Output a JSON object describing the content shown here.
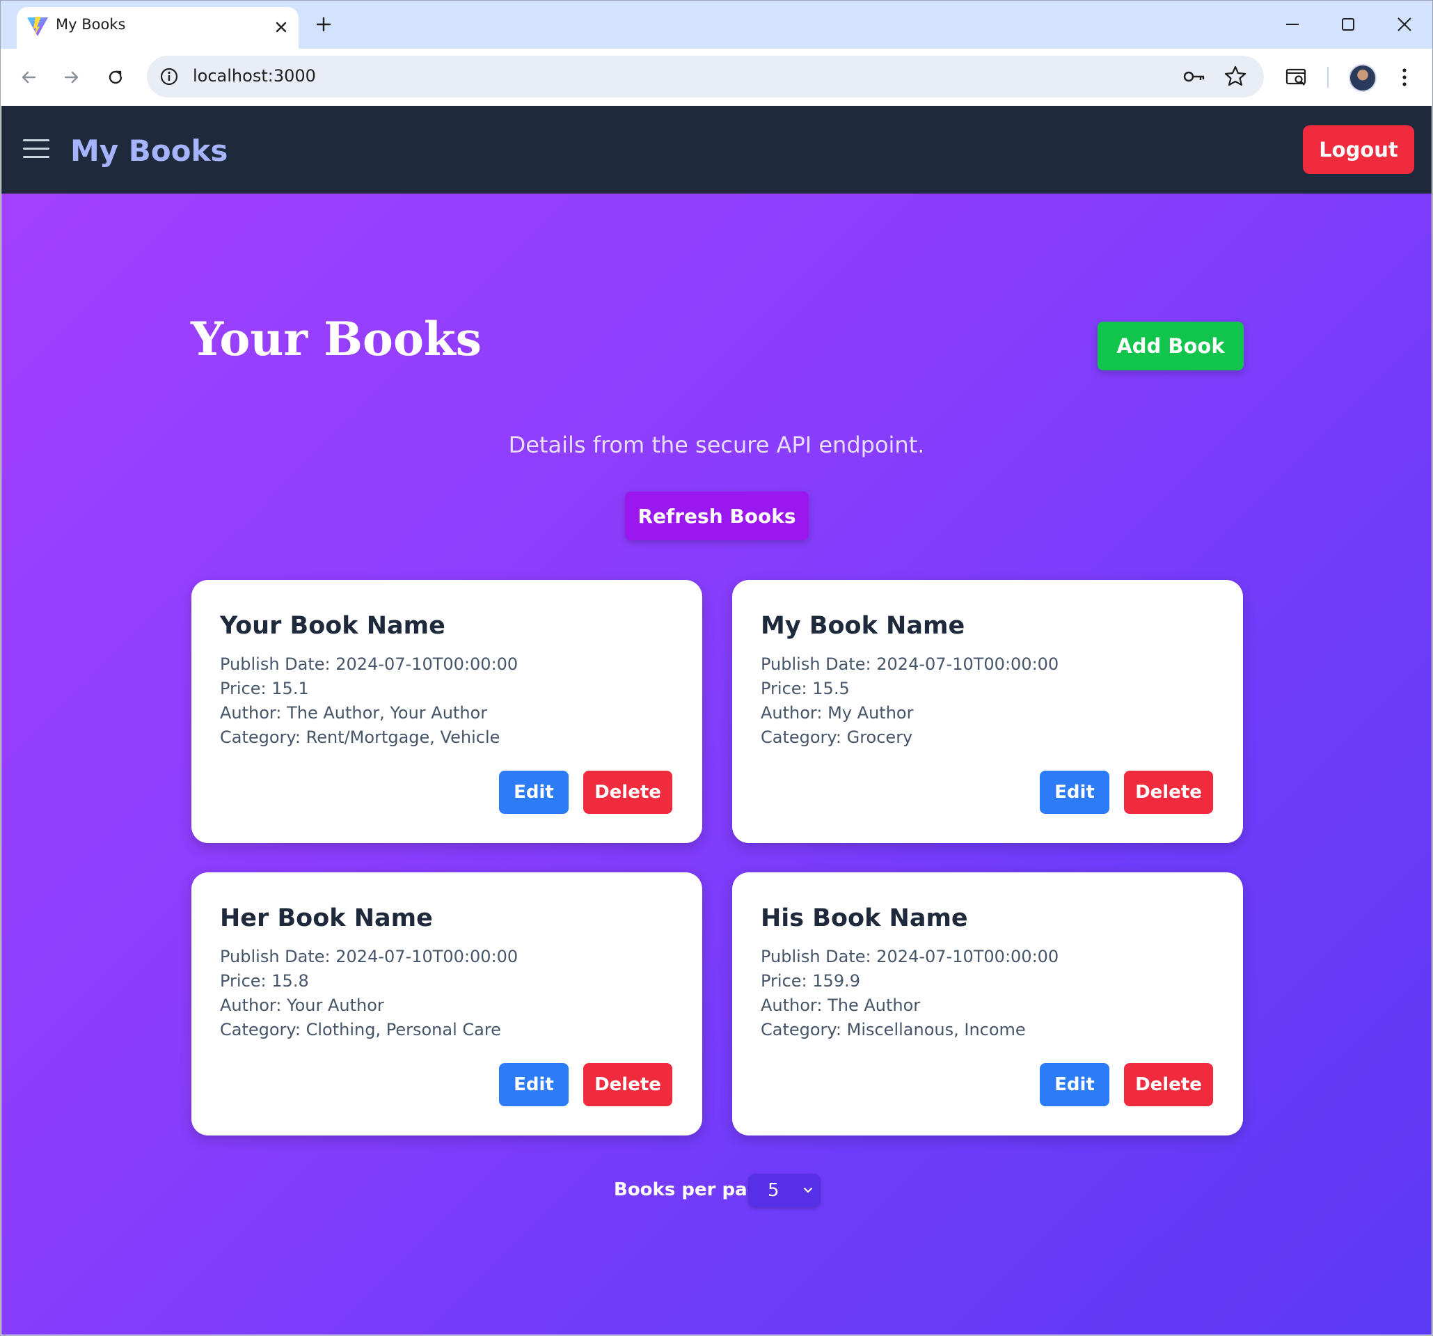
{
  "browser": {
    "tab_title": "My Books",
    "url": "localhost:3000"
  },
  "app": {
    "brand": "My Books",
    "logout_label": "Logout"
  },
  "main": {
    "title": "Your Books",
    "add_label": "Add Book",
    "subtitle": "Details from the secure API endpoint.",
    "refresh_label": "Refresh Books",
    "per_page_label": "Books per page:",
    "per_page_value": "5"
  },
  "labels": {
    "publish": "Publish Date:",
    "price": "Price:",
    "author": "Author:",
    "category": "Category:",
    "edit": "Edit",
    "delete": "Delete"
  },
  "books": [
    {
      "name": "Your Book Name",
      "publish_date": "2024-07-10T00:00:00",
      "price": "15.1",
      "author": "The Author, Your Author",
      "category": "Rent/Mortgage, Vehicle"
    },
    {
      "name": "My Book Name",
      "publish_date": "2024-07-10T00:00:00",
      "price": "15.5",
      "author": "My Author",
      "category": "Grocery"
    },
    {
      "name": "Her Book Name",
      "publish_date": "2024-07-10T00:00:00",
      "price": "15.8",
      "author": "Your Author",
      "category": "Clothing, Personal Care"
    },
    {
      "name": "His Book Name",
      "publish_date": "2024-07-10T00:00:00",
      "price": "159.9",
      "author": "The Author",
      "category": "Miscellanous, Income"
    }
  ],
  "colors": {
    "navbar": "#1e293b",
    "brand": "#a5b4fc",
    "danger": "#ef2b3d",
    "success": "#10c44c",
    "primary": "#2b7cf6",
    "refresh": "#9b17f0",
    "gradient_start": "#a240ff",
    "gradient_end": "#5b3af5"
  },
  "icons": [
    "vite-favicon-icon",
    "close-icon",
    "plus-icon",
    "minimize-icon",
    "maximize-icon",
    "close-window-icon",
    "back-arrow-icon",
    "forward-arrow-icon",
    "reload-icon",
    "info-icon",
    "key-icon",
    "star-icon",
    "search-tab-icon",
    "profile-avatar",
    "more-vert-icon",
    "hamburger-icon",
    "chevron-down-icon"
  ]
}
